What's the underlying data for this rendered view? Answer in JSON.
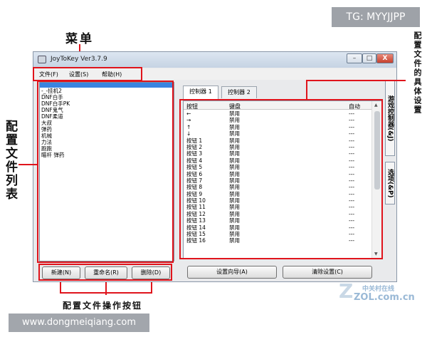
{
  "window": {
    "title": "JoyToKey Ver3.7.9",
    "min_glyph": "–",
    "max_glyph": "□",
    "close_glyph": "X"
  },
  "menu": {
    "items": [
      "文件(F)",
      "设置(S)",
      "帮助(H)"
    ]
  },
  "profiles": {
    "items": [
      "-_-挂机2",
      "DNF白手",
      "DNF白手PK",
      "DNF鬼气",
      "DNF柔道",
      "大叔",
      "弹药",
      "机械",
      "力法",
      "跑跑",
      "瞄杆 弹药"
    ]
  },
  "profile_buttons": [
    "新建(N)",
    "重命名(R)",
    "删除(D)"
  ],
  "tabs": [
    "控制器 1",
    "控制器 2"
  ],
  "side_tabs": [
    "游戏控制器(&J)",
    "选项(&P)"
  ],
  "grid": {
    "headers": [
      "按钮",
      "键盘",
      "自动"
    ],
    "rows": [
      [
        "←",
        "禁用",
        "---"
      ],
      [
        "→",
        "禁用",
        "---"
      ],
      [
        "↑",
        "禁用",
        "---"
      ],
      [
        "↓",
        "禁用",
        "---"
      ],
      [
        "按钮 1",
        "禁用",
        "---"
      ],
      [
        "按钮 2",
        "禁用",
        "---"
      ],
      [
        "按钮 3",
        "禁用",
        "---"
      ],
      [
        "按钮 4",
        "禁用",
        "---"
      ],
      [
        "按钮 5",
        "禁用",
        "---"
      ],
      [
        "按钮 6",
        "禁用",
        "---"
      ],
      [
        "按钮 7",
        "禁用",
        "---"
      ],
      [
        "按钮 8",
        "禁用",
        "---"
      ],
      [
        "按钮 9",
        "禁用",
        "---"
      ],
      [
        "按钮 10",
        "禁用",
        "---"
      ],
      [
        "按钮 11",
        "禁用",
        "---"
      ],
      [
        "按钮 12",
        "禁用",
        "---"
      ],
      [
        "按钮 13",
        "禁用",
        "---"
      ],
      [
        "按钮 14",
        "禁用",
        "---"
      ],
      [
        "按钮 15",
        "禁用",
        "---"
      ],
      [
        "按钮 16",
        "禁用",
        "---"
      ]
    ]
  },
  "bottom_buttons": [
    "设置向导(A)",
    "清除设置(C)"
  ],
  "annotations": {
    "menu": "菜单",
    "profile_list": "配置文件列表",
    "profile_ops": "配置文件操作按钮",
    "config_detail": "配置文件的具体设置"
  },
  "overlays": {
    "telegram": "TG: MYYJJPP",
    "website": "www.dongmeiqiang.com",
    "wm_line1": "中关村在线",
    "wm_line2": "ZOL.com.cn",
    "wm_logo": "Z"
  },
  "colors": {
    "highlight": "#e0141c",
    "selection": "#3a84e0"
  }
}
